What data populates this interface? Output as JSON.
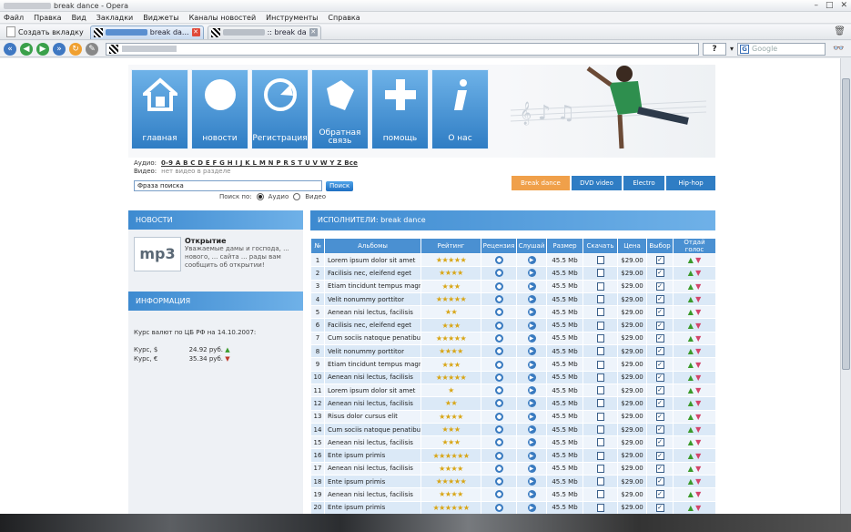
{
  "window": {
    "title": "break dance - Opera",
    "controls": [
      "–",
      "□",
      "✕"
    ]
  },
  "menu": [
    "Файл",
    "Правка",
    "Вид",
    "Закладки",
    "Виджеты",
    "Каналы новостей",
    "Инструменты",
    "Справка"
  ],
  "tabs": {
    "new_tab_label": "Создать вкладку",
    "items": [
      {
        "title": "break da...",
        "active": true
      },
      {
        "title": ":: break da",
        "active": false
      }
    ]
  },
  "addressbar": {
    "help": "?",
    "search_placeholder": "Google"
  },
  "site": {
    "nav": [
      {
        "label": "главная",
        "icon": "home-icon"
      },
      {
        "label": "новости",
        "icon": "circle-icon"
      },
      {
        "label": "Регистрация",
        "icon": "register-icon"
      },
      {
        "label": "Обратная связь",
        "icon": "feedback-icon"
      },
      {
        "label": "помощь",
        "icon": "plus-icon"
      },
      {
        "label": "О нас",
        "icon": "info-icon"
      }
    ],
    "alpha": {
      "audio_label": "Аудио:",
      "letters": "0-9 A B C D E F G H I J K L M N P R S T U V W Y Z Все",
      "video_label": "Видео:",
      "video_note": "нет видео в разделе"
    },
    "search": {
      "value": "Фраза поиска",
      "button": "Поиск",
      "by_label": "Поиск по:",
      "opt_audio": "Аудио",
      "opt_video": "Видео"
    },
    "genres": [
      "Break dance",
      "DVD video",
      "Electro",
      "Hip-hop"
    ],
    "news": {
      "header": "НОВОСТИ",
      "logo": "mp3",
      "title": "Открытие",
      "body": "Уважаемые дамы и господа, ... нового, ... сайта ... рады вам сообщить об открытии!"
    },
    "info": {
      "header": "ИНФОРМАЦИЯ",
      "rate_title": "Курс валют по ЦБ РФ на 14.10.2007:",
      "usd_label": "Курс, $",
      "usd_value": "24.92 руб.",
      "eur_label": "Курс, €",
      "eur_value": "35.34 руб."
    },
    "table": {
      "header": "ИСПОЛНИТЕЛИ: break dance",
      "columns": [
        "№",
        "Альбомы",
        "Рейтинг",
        "Рецензия",
        "Слушай",
        "Размер",
        "Скачать",
        "Цена",
        "Выбор",
        "Отдай голос"
      ],
      "rows": [
        {
          "n": "1",
          "album": "Lorem ipsum dolor sit amet",
          "stars": 5,
          "size": "45.5 Mb",
          "price": "$29.00"
        },
        {
          "n": "2",
          "album": "Facilisis nec, eleifend eget",
          "stars": 4,
          "size": "45.5 Mb",
          "price": "$29.00"
        },
        {
          "n": "3",
          "album": "Etiam tincidunt tempus magn",
          "stars": 3,
          "size": "45.5 Mb",
          "price": "$29.00"
        },
        {
          "n": "4",
          "album": "Velit nonummy porttitor",
          "stars": 5,
          "size": "45.5 Mb",
          "price": "$29.00"
        },
        {
          "n": "5",
          "album": "Aenean nisi lectus, facilisis",
          "stars": 2,
          "size": "45.5 Mb",
          "price": "$29.00"
        },
        {
          "n": "6",
          "album": "Facilisis nec, eleifend eget",
          "stars": 3,
          "size": "45.5 Mb",
          "price": "$29.00"
        },
        {
          "n": "7",
          "album": "Cum sociis natoque penatibus",
          "stars": 5,
          "size": "45.5 Mb",
          "price": "$29.00"
        },
        {
          "n": "8",
          "album": "Velit nonummy porttitor",
          "stars": 4,
          "size": "45.5 Mb",
          "price": "$29.00"
        },
        {
          "n": "9",
          "album": "Etiam tincidunt tempus magna",
          "stars": 3,
          "size": "45.5 Mb",
          "price": "$29.00"
        },
        {
          "n": "10",
          "album": "Aenean nisi lectus, facilisis",
          "stars": 5,
          "size": "45.5 Mb",
          "price": "$29.00"
        },
        {
          "n": "11",
          "album": "Lorem ipsum dolor sit amet",
          "stars": 1,
          "size": "45.5 Mb",
          "price": "$29.00"
        },
        {
          "n": "12",
          "album": "Aenean nisi lectus, facilisis",
          "stars": 2,
          "size": "45.5 Mb",
          "price": "$29.00"
        },
        {
          "n": "13",
          "album": "Risus dolor cursus elit",
          "stars": 4,
          "size": "45.5 Mb",
          "price": "$29.00"
        },
        {
          "n": "14",
          "album": "Cum sociis natoque penatibus",
          "stars": 3,
          "size": "45.5 Mb",
          "price": "$29.00"
        },
        {
          "n": "15",
          "album": "Aenean nisi lectus, facilisis",
          "stars": 3,
          "size": "45.5 Mb",
          "price": "$29.00"
        },
        {
          "n": "16",
          "album": "Ente ipsum primis",
          "stars": 6,
          "size": "45.5 Mb",
          "price": "$29.00"
        },
        {
          "n": "17",
          "album": "Aenean nisi lectus, facilisis",
          "stars": 4,
          "size": "45.5 Mb",
          "price": "$29.00"
        },
        {
          "n": "18",
          "album": "Ente ipsum primis",
          "stars": 5,
          "size": "45.5 Mb",
          "price": "$29.00"
        },
        {
          "n": "19",
          "album": "Aenean nisi lectus, facilisis",
          "stars": 4,
          "size": "45.5 Mb",
          "price": "$29.00"
        },
        {
          "n": "20",
          "album": "Ente ipsum primis",
          "stars": 6,
          "size": "45.5 Mb",
          "price": "$29.00"
        }
      ]
    }
  },
  "colors": {
    "accent": "#2f7dc4",
    "active_genre": "#f0a04a",
    "star": "#d8a514"
  }
}
